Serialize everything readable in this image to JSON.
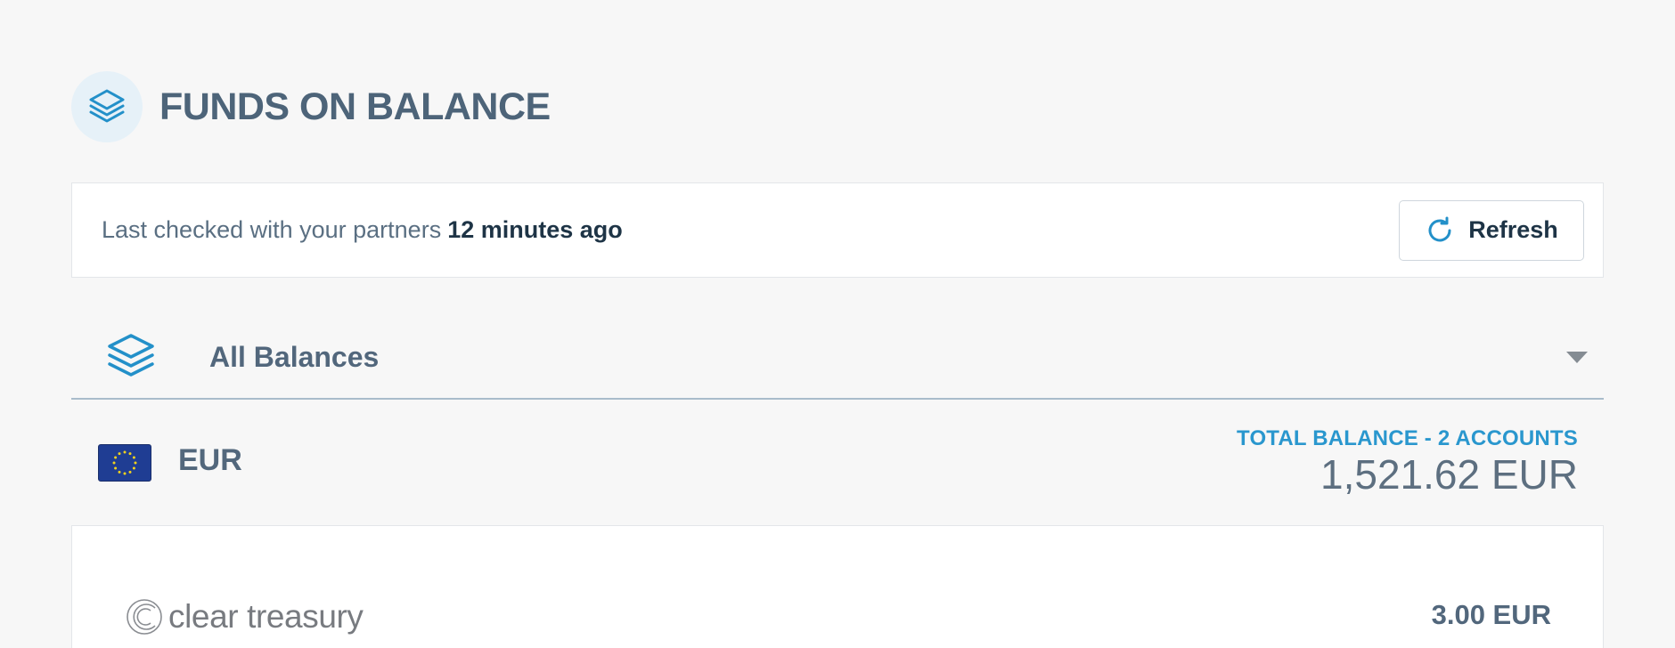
{
  "header": {
    "title": "FUNDS ON BALANCE",
    "icon": "layers-icon"
  },
  "status": {
    "prefix": "Last checked with your partners",
    "time": "12 minutes ago",
    "refresh_label": "Refresh",
    "refresh_icon": "refresh-icon"
  },
  "balance_select": {
    "selected": "All Balances",
    "icon": "layers-icon"
  },
  "currency": {
    "code": "EUR",
    "flag": "eu-flag-icon",
    "total_label": "TOTAL BALANCE - 2 ACCOUNTS",
    "total_amount": "1,521.62 EUR"
  },
  "accounts": [
    {
      "provider": "clear treasury",
      "amount": "3.00 EUR"
    }
  ],
  "colors": {
    "accent": "#2a97ce",
    "title": "#4d6479",
    "background": "#f7f7f7"
  }
}
